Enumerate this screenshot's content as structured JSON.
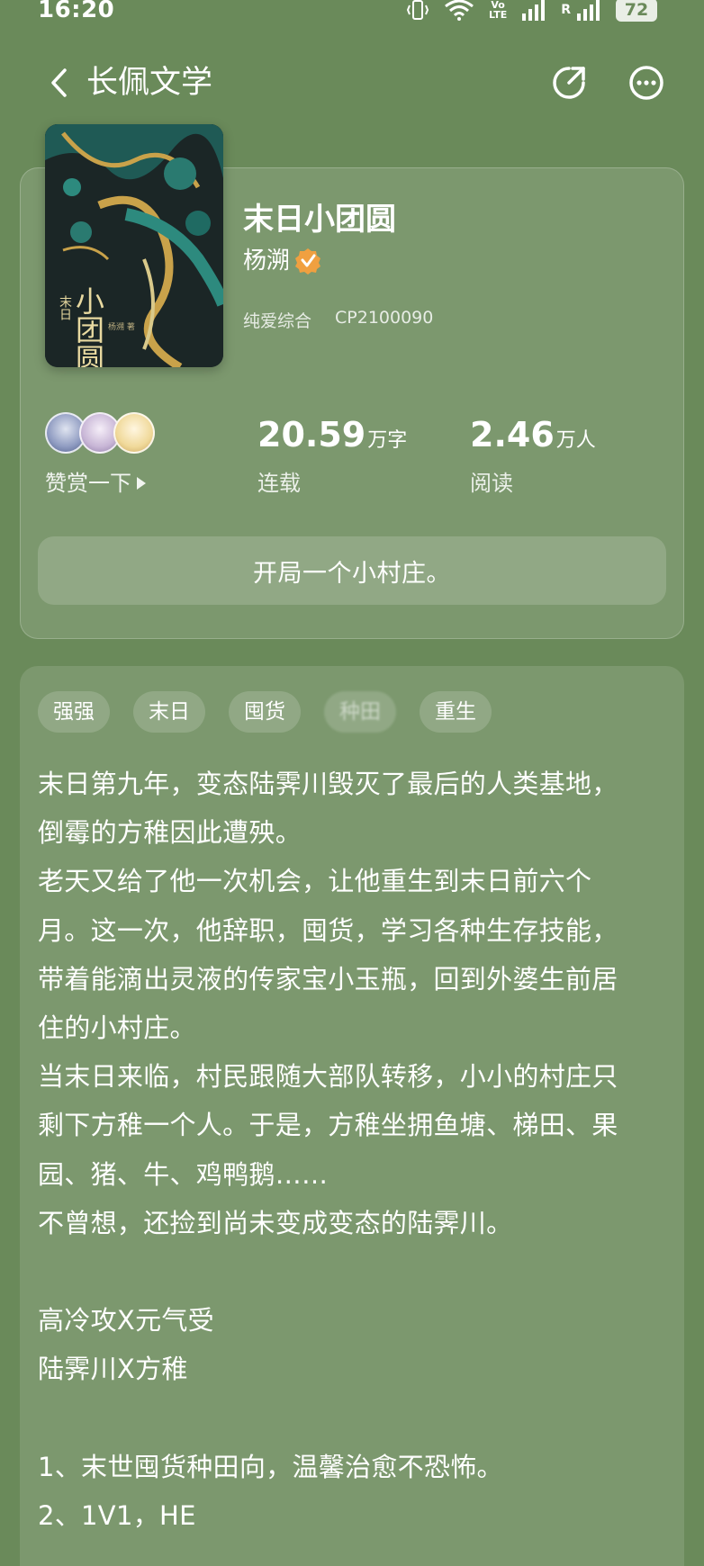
{
  "status": {
    "time": "16:20",
    "network_label": "LTE",
    "roaming_mark": "R",
    "battery": "72"
  },
  "nav": {
    "title": "长佩文学"
  },
  "book": {
    "title": "末日小团圆",
    "author": "杨溯",
    "category": "纯爱综合",
    "cp_code": "CP2100090",
    "cover": {
      "small_title": "末日",
      "big_title": "小团圆",
      "author_mark": "杨溯 著"
    }
  },
  "stats": {
    "reward_label": "赞赏一下",
    "word_count": "20.59",
    "word_unit": "万字",
    "status": "连载",
    "readers": "2.46",
    "readers_unit": "万人",
    "readers_label": "阅读"
  },
  "latest_chapter": "开局一个小村庄。",
  "tags": [
    "强强",
    "末日",
    "囤货",
    "种田",
    "重生"
  ],
  "description": [
    "末日第九年，变态陆霁川毁灭了最后的人类基地，",
    "倒霉的方稚因此遭殃。",
    "老天又给了他一次机会，让他重生到末日前六个",
    "月。这一次，他辞职，囤货，学习各种生存技能，",
    "带着能滴出灵液的传家宝小玉瓶，回到外婆生前居",
    "住的小村庄。",
    "当末日来临，村民跟随大部队转移，小小的村庄只",
    "剩下方稚一个人。于是，方稚坐拥鱼塘、梯田、果",
    "园、猪、牛、鸡鸭鹅……",
    "不曾想，还捡到尚未变成变态的陆霁川。",
    "",
    "高冷攻X元气受",
    "陆霁川X方稚",
    "",
    "1、末世囤货种田向，温馨治愈不恐怖。",
    "2、1V1，HE"
  ],
  "icons": {
    "back": "chevron-left-icon",
    "share": "share-icon",
    "more": "more-icon",
    "verified": "verified-badge-icon",
    "reward_arrow": "play-triangle-icon"
  },
  "colors": {
    "background": "#6a8a5a",
    "verified_badge": "#f0a040"
  }
}
